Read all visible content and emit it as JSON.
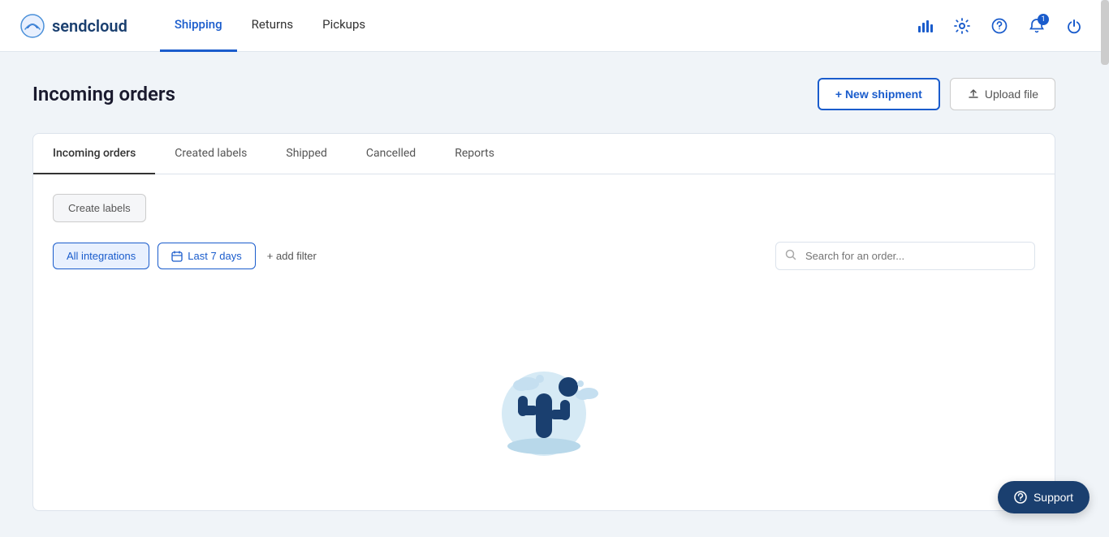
{
  "brand": {
    "name": "sendcloud",
    "logo_alt": "sendcloud logo"
  },
  "navbar": {
    "nav_items": [
      {
        "label": "Shipping",
        "active": true
      },
      {
        "label": "Returns",
        "active": false
      },
      {
        "label": "Pickups",
        "active": false
      }
    ],
    "icons": {
      "chart": "📊",
      "settings": "⚙",
      "help": "?",
      "notification": "🔔",
      "notification_count": "1",
      "power": "⏻"
    }
  },
  "page": {
    "title": "Incoming orders",
    "actions": {
      "new_shipment": "+ New shipment",
      "upload_file": "Upload file"
    }
  },
  "tabs": [
    {
      "label": "Incoming orders",
      "active": true
    },
    {
      "label": "Created labels",
      "active": false
    },
    {
      "label": "Shipped",
      "active": false
    },
    {
      "label": "Cancelled",
      "active": false
    },
    {
      "label": "Reports",
      "active": false
    }
  ],
  "toolbar": {
    "create_labels": "Create labels"
  },
  "filters": {
    "integrations_label": "All integrations",
    "date_label": "Last 7 days",
    "add_filter": "+ add filter"
  },
  "search": {
    "placeholder": "Search for an order..."
  },
  "support": {
    "label": "Support",
    "icon": "?"
  }
}
